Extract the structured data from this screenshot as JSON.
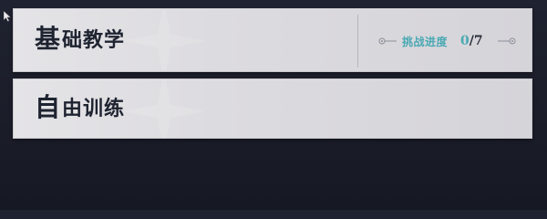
{
  "panels": [
    {
      "title_first": "基",
      "title_rest": "础教学",
      "progress": {
        "label": "挑战进度",
        "current": "0",
        "separator": "/",
        "total": "7"
      }
    },
    {
      "title_first": "自",
      "title_rest": "由训练"
    }
  ],
  "colors": {
    "accent": "#4aa9b4",
    "title": "#1e2330",
    "panel": "#dcdbdf",
    "background": "#1c1e2a"
  },
  "icons": {
    "cursor": "mouse-pointer-icon",
    "ornament": "line-ornament-icon"
  }
}
